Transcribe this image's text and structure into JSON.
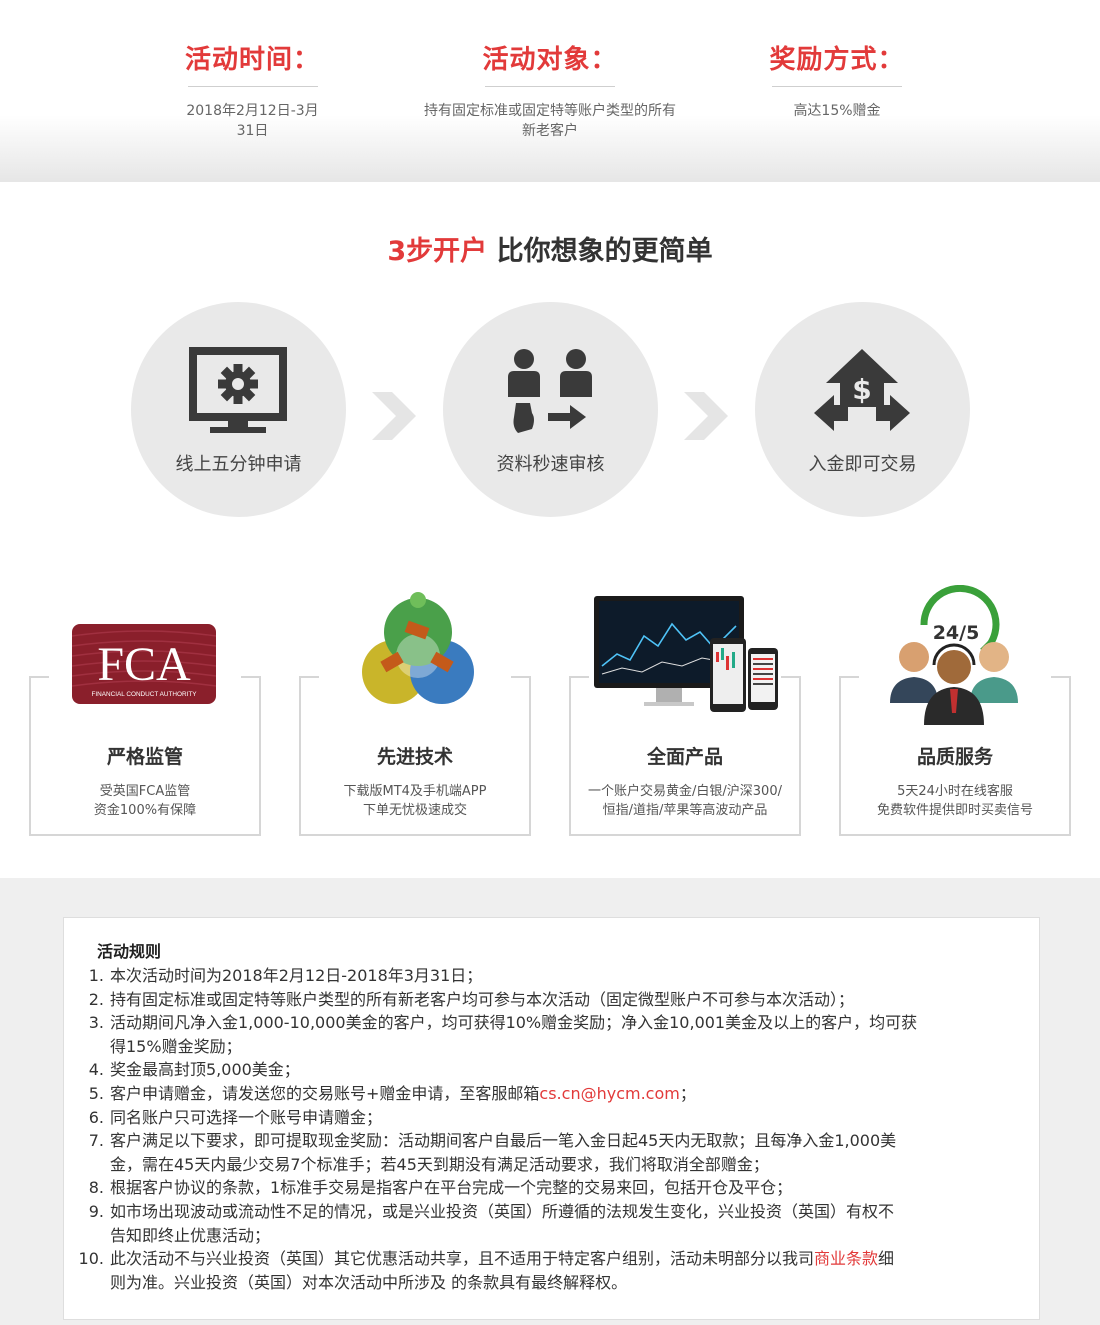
{
  "info": {
    "columns": [
      {
        "title": "活动时间：",
        "text": "2018年2月12日-3月31日"
      },
      {
        "title": "活动对象：",
        "text_line1": "持有固定标准或固定特等账户类型的所有",
        "text_line2": "新老客户"
      },
      {
        "title": "奖励方式：",
        "text": "高达15%赠金"
      }
    ]
  },
  "steps": {
    "heading_red": "3步开户",
    "heading_rest": " 比你想象的更简单",
    "items": [
      {
        "label": "线上五分钟申请",
        "icon": "monitor-gear-icon"
      },
      {
        "label": "资料秒速审核",
        "icon": "people-exchange-icon"
      },
      {
        "label": "入金即可交易",
        "icon": "dollar-house-arrows-icon"
      }
    ]
  },
  "features": [
    {
      "title": "严格监管",
      "desc_line1": "受英国FCA监管",
      "desc_line2": "资金100%有保障",
      "logo_text": "FCA",
      "logo_sub": "FINANCIAL CONDUCT AUTHORITY"
    },
    {
      "title": "先进技术",
      "desc_line1": "下载版MT4及手机端APP",
      "desc_line2": "下单无忧极速成交",
      "icon": "metatrader-logo-icon"
    },
    {
      "title": "全面产品",
      "desc_line1": "一个账户交易黄金/白银/沪深300/",
      "desc_line2": "恒指/道指/苹果等高波动产品",
      "icon": "devices-chart-icon"
    },
    {
      "title": "品质服务",
      "desc_line1": "5天24小时在线客服",
      "desc_line2": "免费软件提供即时买卖信号",
      "badge": "24/5",
      "icon": "support-agents-icon"
    }
  ],
  "rules": {
    "title": "活动规则",
    "items": [
      {
        "num": "1.",
        "lines": [
          "本次活动时间为2018年2月12日-2018年3月31日；"
        ]
      },
      {
        "num": "2.",
        "lines": [
          "持有固定标准或固定特等账户类型的所有新老客户均可参与本次活动（固定微型账户不可参与本次活动）；"
        ]
      },
      {
        "num": "3.",
        "lines": [
          "活动期间凡净入金1,000-10,000美金的客户，均可获得10%赠金奖励；净入金10,001美金及以上的客户，均可获",
          "得15%赠金奖励；"
        ]
      },
      {
        "num": "4.",
        "lines": [
          "奖金最高封顶5,000美金；"
        ]
      },
      {
        "num": "5.",
        "pre": "客户申请赠金，请发送您的交易账号+赠金申请，至客服邮箱",
        "email": "cs.cn@hycm.com",
        "post": "；"
      },
      {
        "num": "6.",
        "lines": [
          "同名账户只可选择一个账号申请赠金；"
        ]
      },
      {
        "num": "7.",
        "lines": [
          "客户满足以下要求，即可提取现金奖励：活动期间客户自最后一笔入金日起45天内无取款；且每净入金1,000美",
          "金，需在45天内最少交易7个标准手；若45天到期没有满足活动要求，我们将取消全部赠金；"
        ]
      },
      {
        "num": "8.",
        "lines": [
          "根据客户协议的条款，1标准手交易是指客户在平台完成一个完整的交易来回，包括开仓及平仓；"
        ]
      },
      {
        "num": "9.",
        "lines": [
          "如市场出现波动或流动性不足的情况，或是兴业投资（英国）所遵循的法规发生变化，兴业投资（英国）有权不",
          "告知即终止优惠活动；"
        ]
      },
      {
        "num": "10.",
        "pre": "此次活动不与兴业投资（英国）其它优惠活动共享，且不适用于特定客户组别，活动未明部分以我司",
        "link": "商业条款",
        "post": "细",
        "line2": "则为准。兴业投资（英国）对本次活动中所涉及 的条款具有最终解释权。"
      }
    ]
  },
  "colors": {
    "accent": "#e23a3a",
    "fca": "#8a1f2b",
    "circle": "#e9e9e9",
    "icon": "#3a3a3a"
  }
}
